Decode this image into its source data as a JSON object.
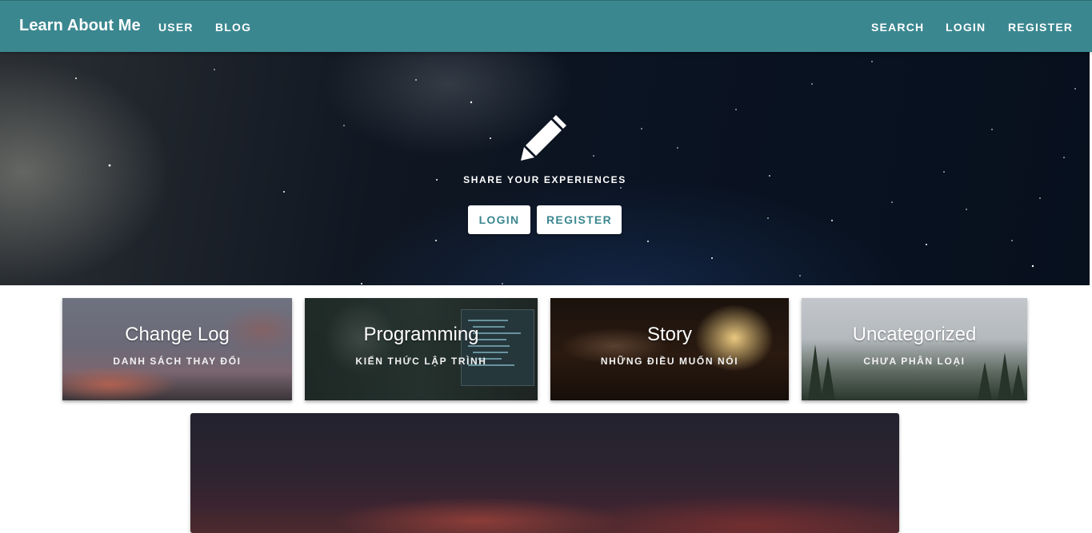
{
  "navbar": {
    "brand": "Learn About Me",
    "left_links": [
      "USER",
      "BLOG"
    ],
    "right_links": [
      "SEARCH",
      "LOGIN",
      "REGISTER"
    ],
    "color": "#3b8790"
  },
  "hero": {
    "icon": "pencil-icon",
    "tagline": "SHARE YOUR EXPERIENCES",
    "buttons": [
      "LOGIN",
      "REGISTER"
    ]
  },
  "categories": [
    {
      "title": "Change Log",
      "subtitle": "DANH SÁCH THAY ĐỔI"
    },
    {
      "title": "Programming",
      "subtitle": "KIẾN THỨC LẬP TRÌNH"
    },
    {
      "title": "Story",
      "subtitle": "NHỮNG ĐIỀU MUỐN NÓI"
    },
    {
      "title": "Uncategorized",
      "subtitle": "CHƯA PHÂN LOẠI"
    }
  ]
}
